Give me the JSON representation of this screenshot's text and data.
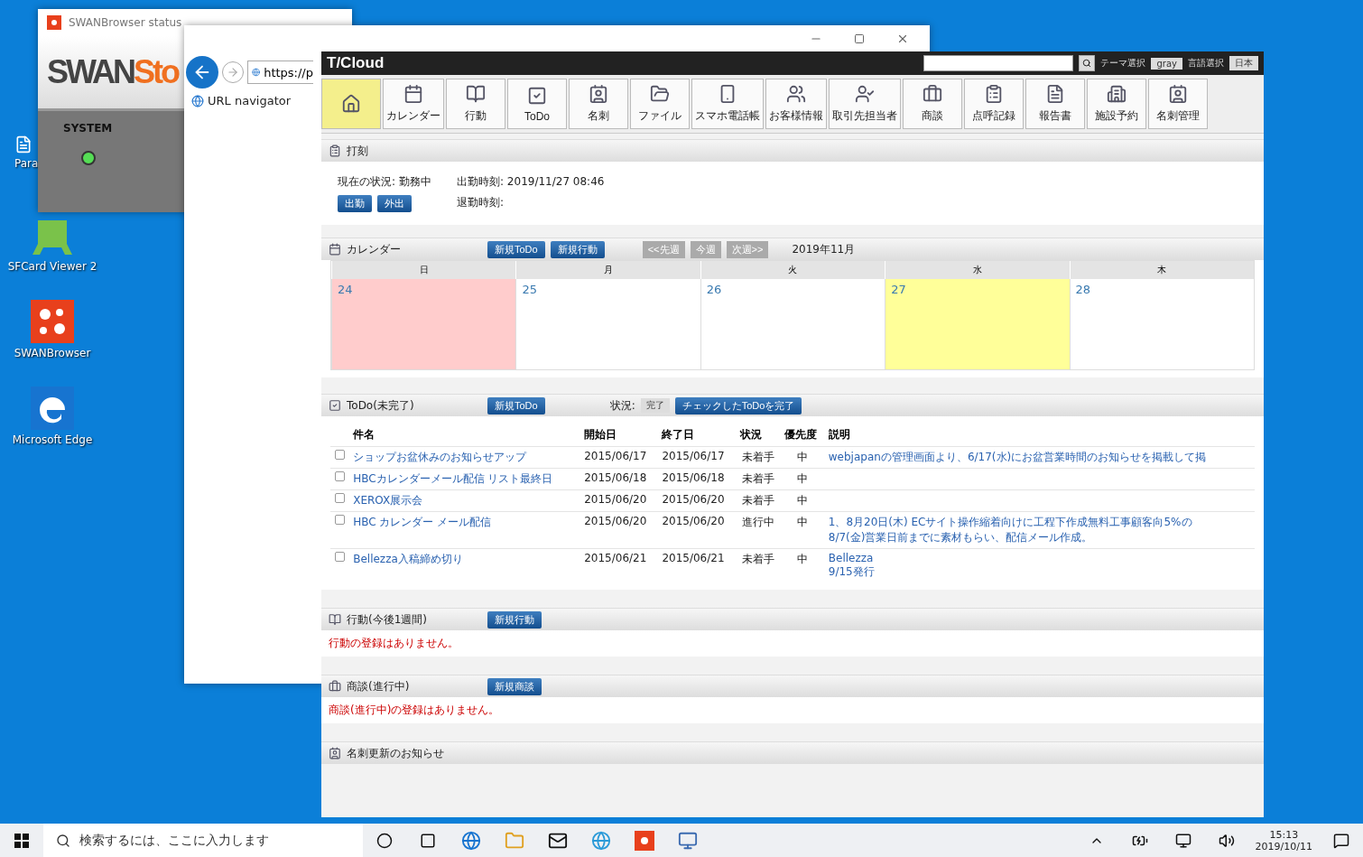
{
  "desktop_icons": [
    {
      "label": "Para",
      "kind": "doc"
    },
    {
      "label": "SFCard Viewer 2",
      "kind": "train"
    },
    {
      "label": "SWANBrowser",
      "kind": "swan"
    },
    {
      "label": "Microsoft Edge",
      "kind": "edge"
    }
  ],
  "status_window": {
    "title": "SWANBrowser status",
    "logo_dark": "SWAN",
    "logo_accent": "Sto",
    "section": "SYSTEM",
    "led_on": true
  },
  "navigator_window": {
    "address": "https://p",
    "items": [
      "URL navigator"
    ]
  },
  "tcloud": {
    "logo": "T/Cloud",
    "theme_label": "テーマ選択",
    "theme_value": "gray",
    "lang_label": "言語選択",
    "lang_value": "日本",
    "toolbar": [
      {
        "kind": "home",
        "selected": true
      },
      {
        "label": "カレンダー",
        "kind": "calendar",
        "selected": false
      },
      {
        "label": "行動",
        "kind": "book",
        "selected": false
      },
      {
        "label": "ToDo",
        "kind": "todo",
        "selected": false
      },
      {
        "label": "名刺",
        "kind": "card",
        "selected": false
      },
      {
        "label": "ファイル",
        "kind": "folder",
        "selected": false
      },
      {
        "label": "スマホ電話帳",
        "kind": "phone",
        "selected": false
      },
      {
        "label": "お客様情報",
        "kind": "users",
        "selected": false
      },
      {
        "label": "取引先担当者",
        "kind": "person",
        "selected": false
      },
      {
        "label": "商談",
        "kind": "briefcase",
        "selected": false
      },
      {
        "label": "点呼記録",
        "kind": "clipboard",
        "selected": false
      },
      {
        "label": "報告書",
        "kind": "report",
        "selected": false
      },
      {
        "label": "施設予約",
        "kind": "building",
        "selected": false
      },
      {
        "label": "名刺管理",
        "kind": "card",
        "selected": false
      }
    ],
    "punch": {
      "title": "打刻",
      "status": "現在の状況: 勤務中",
      "clock_in": "出勤時刻: 2019/11/27 08:46",
      "clock_out": "退勤時刻:",
      "buttons": [
        "出勤",
        "外出"
      ]
    },
    "calendar": {
      "title": "カレンダー",
      "buttons": [
        "新規ToDo",
        "新規行動"
      ],
      "nav": [
        "<<先週",
        "今週",
        "次週>>"
      ],
      "month": "2019年11月",
      "days": [
        {
          "weekday": "日",
          "date": "24",
          "holiday": true,
          "today": false
        },
        {
          "weekday": "月",
          "date": "25",
          "holiday": false,
          "today": false
        },
        {
          "weekday": "火",
          "date": "26",
          "holiday": false,
          "today": false
        },
        {
          "weekday": "水",
          "date": "27",
          "holiday": false,
          "today": true
        },
        {
          "weekday": "木",
          "date": "28",
          "holiday": false,
          "today": false
        }
      ]
    },
    "todo": {
      "title": "ToDo(未完了)",
      "new_button": "新規ToDo",
      "status_label": "状況:",
      "status_value": "完了",
      "complete_button": "チェックしたToDoを完了",
      "columns": [
        "件名",
        "開始日",
        "終了日",
        "状況",
        "優先度",
        "説明"
      ],
      "rows": [
        {
          "checked": false,
          "subject": "ショップお盆休みのお知らせアップ",
          "start": "2015/06/17",
          "end": "2015/06/17",
          "status": "未着手",
          "priority": "中",
          "notes": [
            "webjapanの管理画面より、6/17(水)にお盆営業時間のお知らせを掲載して掲"
          ]
        },
        {
          "checked": false,
          "subject": "HBCカレンダーメール配信 リスト最終日",
          "start": "2015/06/18",
          "end": "2015/06/18",
          "status": "未着手",
          "priority": "中",
          "notes": []
        },
        {
          "checked": false,
          "subject": "XEROX展示会",
          "start": "2015/06/20",
          "end": "2015/06/20",
          "status": "未着手",
          "priority": "中",
          "notes": []
        },
        {
          "checked": false,
          "subject": "HBC カレンダー メール配信",
          "start": "2015/06/20",
          "end": "2015/06/20",
          "status": "進行中",
          "priority": "中",
          "notes": [
            "1、8月20日(木) ECサイト操作縮着向けに工程下作成無料工事顧客向5%の",
            "8/7(金)営業日前までに素材もらい、配信メール作成。"
          ]
        },
        {
          "checked": false,
          "subject": "Bellezza入稿締め切り",
          "start": "2015/06/21",
          "end": "2015/06/21",
          "status": "未着手",
          "priority": "中",
          "notes": [
            "Bellezza",
            "9/15発行"
          ]
        }
      ]
    },
    "sections": [
      {
        "title": "行動(今後1週間)",
        "kind": "book",
        "button": "新規行動",
        "message": "行動の登録はありません。"
      },
      {
        "title": "商談(進行中)",
        "kind": "briefcase",
        "button": "新規商談",
        "message": "商談(進行中)の登録はありません。"
      },
      {
        "title": "名刺更新のお知らせ",
        "kind": "card"
      }
    ]
  },
  "taskbar": {
    "search_placeholder": "検索するには、ここに入力します",
    "time": "15:13",
    "date": "2019/10/11"
  }
}
